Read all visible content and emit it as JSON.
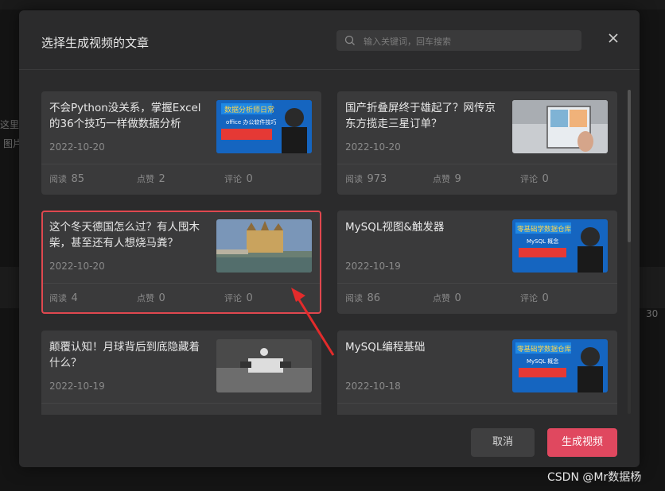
{
  "background": {
    "side_text_1": "这里",
    "side_text_2": "图片",
    "time_text": "30"
  },
  "dialog": {
    "title": "选择生成视频的文章",
    "search_placeholder": "输入关键词，回车搜索",
    "close_icon": "close-icon",
    "cancel_label": "取消",
    "generate_label": "生成视频"
  },
  "stat_labels": {
    "read": "阅读",
    "like": "点赞",
    "comment": "评论"
  },
  "articles": [
    {
      "title": "不会Python没关系，掌握Excel的36个技巧一样做数据分析",
      "date": "2022-10-20",
      "reads": "85",
      "likes": "2",
      "comments": "0",
      "thumb_caption": "数据分析师日常",
      "thumb_sub": "office 办公软件技巧"
    },
    {
      "title": "国产折叠屏终于雄起了？网传京东方揽走三星订单？",
      "date": "2022-10-20",
      "reads": "973",
      "likes": "9",
      "comments": "0"
    },
    {
      "title": "这个冬天德国怎么过？有人囤木柴，甚至还有人想烧马粪？",
      "date": "2022-10-20",
      "reads": "4",
      "likes": "0",
      "comments": "0"
    },
    {
      "title": "MySQL视图&触发器",
      "date": "2022-10-19",
      "reads": "86",
      "likes": "0",
      "comments": "0",
      "thumb_caption": "零基础学数据仓库",
      "thumb_sub": "MySQL 概念"
    },
    {
      "title": "颠覆认知！月球背后到底隐藏着什么？",
      "date": "2022-10-19",
      "reads": "",
      "likes": "",
      "comments": ""
    },
    {
      "title": "MySQL编程基础",
      "date": "2022-10-18",
      "reads": "",
      "likes": "",
      "comments": "",
      "thumb_caption": "零基础学数据仓库",
      "thumb_sub": "MySQL 概念"
    }
  ],
  "colors": {
    "accent": "#e0485f",
    "selected_border": "#e0484f",
    "arrow": "#e32b2b"
  },
  "watermark": "CSDN @Mr数据杨"
}
